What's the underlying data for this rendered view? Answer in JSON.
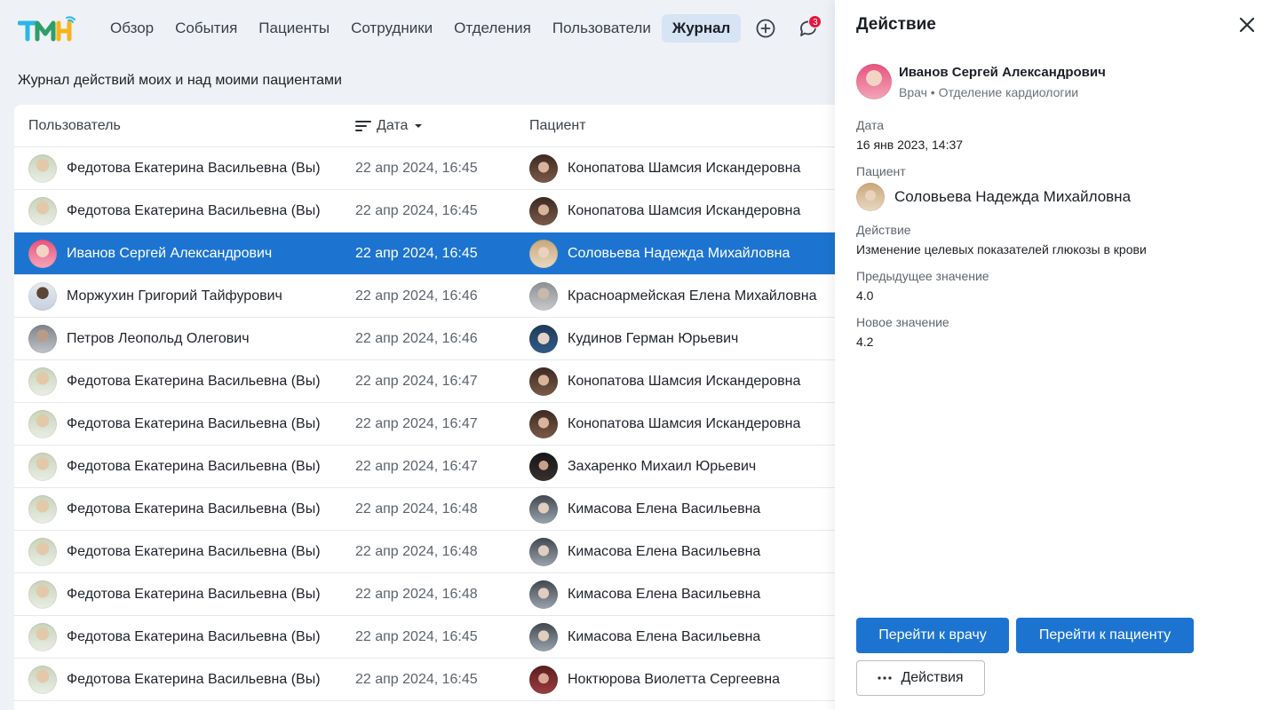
{
  "nav": {
    "items": [
      "Обзор",
      "События",
      "Пациенты",
      "Сотрудники",
      "Отделения",
      "Пользователи",
      "Журнал"
    ],
    "active": "Журнал",
    "notifications_count": "3"
  },
  "page": {
    "subtitle": "Журнал действий моих и над моими пациентами"
  },
  "table": {
    "headers": {
      "user": "Пользователь",
      "date": "Дата",
      "patient": "Пациент"
    },
    "rows": [
      {
        "user": "Федотова Екатерина Васильевна (Вы)",
        "date": "22 апр 2024, 16:45",
        "patient": "Конопатова Шамсия Искандеровна"
      },
      {
        "user": "Федотова Екатерина Васильевна (Вы)",
        "date": "22 апр 2024, 16:45",
        "patient": "Конопатова Шамсия Искандеровна"
      },
      {
        "user": "Иванов Сергей Александрович",
        "date": "22 апр 2024, 16:45",
        "patient": "Соловьева Надежда Михайловна"
      },
      {
        "user": "Моржухин Григорий Тайфурович",
        "date": "22 апр 2024, 16:46",
        "patient": "Красноармейская Елена Михайловна"
      },
      {
        "user": "Петров Леопольд Олегович",
        "date": "22 апр 2024, 16:46",
        "patient": "Кудинов Герман Юрьевич"
      },
      {
        "user": "Федотова Екатерина Васильевна (Вы)",
        "date": "22 апр 2024, 16:47",
        "patient": "Конопатова Шамсия Искандеровна"
      },
      {
        "user": "Федотова Екатерина Васильевна (Вы)",
        "date": "22 апр 2024, 16:47",
        "patient": "Конопатова Шамсия Искандеровна"
      },
      {
        "user": "Федотова Екатерина Васильевна (Вы)",
        "date": "22 апр 2024, 16:47",
        "patient": "Захаренко Михаил Юрьевич"
      },
      {
        "user": "Федотова Екатерина Васильевна (Вы)",
        "date": "22 апр 2024, 16:48",
        "patient": "Кимасова Елена Васильевна"
      },
      {
        "user": "Федотова Екатерина Васильевна (Вы)",
        "date": "22 апр 2024, 16:48",
        "patient": "Кимасова Елена Васильевна"
      },
      {
        "user": "Федотова Екатерина Васильевна (Вы)",
        "date": "22 апр 2024, 16:48",
        "patient": "Кимасова Елена Васильевна"
      },
      {
        "user": "Федотова Екатерина Васильевна (Вы)",
        "date": "22 апр 2024, 16:45",
        "patient": "Кимасова Елена Васильевна"
      },
      {
        "user": "Федотова Екатерина Васильевна (Вы)",
        "date": "22 апр 2024, 16:45",
        "patient": "Ноктюрова Виолетта Сергеевна"
      }
    ]
  },
  "panel": {
    "title": "Действие",
    "doctor_name": "Иванов Сергей Александрович",
    "doctor_role": "Врач • Отделение кардиологии",
    "date_label": "Дата",
    "date_value": "16 янв 2023, 14:37",
    "patient_label": "Пациент",
    "patient_name": "Соловьева Надежда Михайловна",
    "action_label": "Действие",
    "action_value": "Изменение целевых показателей глюкозы в крови",
    "prev_label": "Предыдущее значение",
    "prev_value": "4.0",
    "new_label": "Новое значение",
    "new_value": "4.2",
    "btn_doctor": "Перейти к врачу",
    "btn_patient": "Перейти к пациенту",
    "btn_actions": "Действия"
  },
  "colors": {
    "accent": "#1d74d0",
    "badge": "#e5153b",
    "background": "#eef1f6"
  }
}
